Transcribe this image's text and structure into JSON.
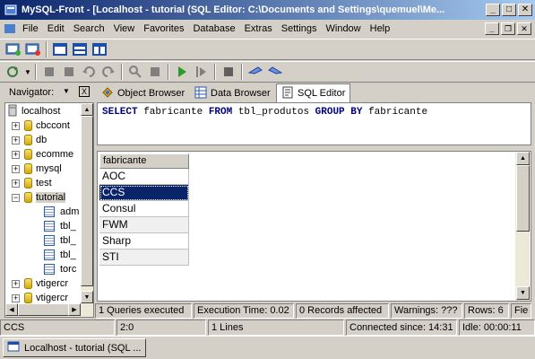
{
  "window": {
    "title": "MySQL-Front - [Localhost - tutorial  (SQL Editor: C:\\Documents and Settings\\quemuel\\Me..."
  },
  "menu": [
    "File",
    "Edit",
    "Search",
    "View",
    "Favorites",
    "Database",
    "Extras",
    "Settings",
    "Window",
    "Help"
  ],
  "navigator": {
    "label": "Navigator:",
    "close": "X"
  },
  "tabs": {
    "object_browser": "Object Browser",
    "data_browser": "Data Browser",
    "sql_editor": "SQL Editor"
  },
  "tree": {
    "root": "localhost",
    "items": [
      "cbccont",
      "db",
      "ecomme",
      "mysql",
      "test",
      "tutorial",
      "adm",
      "tbl_",
      "tbl_",
      "tbl_",
      "torc",
      "vtigercr",
      "vtigercr"
    ]
  },
  "sql": {
    "k1": "SELECT",
    "t1": " fabricante ",
    "k2": "FROM",
    "t2": " tbl_produtos ",
    "k3": "GROUP BY",
    "t3": " fabricante"
  },
  "grid": {
    "header": "fabricante",
    "rows": [
      "AOC",
      "CCS",
      "Consul",
      "FWM",
      "Sharp",
      "STI"
    ]
  },
  "stats": [
    "1 Queries executed",
    "Execution Time: 0.02",
    "0 Records affected",
    "Warnings: ???",
    "Rows: 6",
    "Fie"
  ],
  "status": [
    "CCS",
    "2:0",
    "1 Lines",
    "Connected since: 14:31",
    "Idle: 00:00:11"
  ],
  "taskbar": {
    "item": "Localhost - tutorial  (SQL ..."
  }
}
